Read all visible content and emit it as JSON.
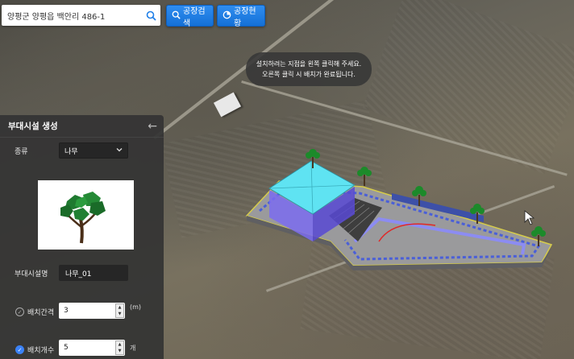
{
  "search": {
    "value": "양평군 양평읍 백안리 486-1",
    "placeholder": ""
  },
  "toolbar": {
    "factory_search_label": "공장검색",
    "factory_status_label": "공장현황"
  },
  "hint": {
    "line1": "설치하려는 지점을 왼쪽 클릭해 주세요.",
    "line2": "오른쪽 클릭 시 배치가 완료됩니다."
  },
  "panel": {
    "title": "부대시설 생성",
    "type_label": "종류",
    "type_value": "나무",
    "name_label": "부대시설명",
    "name_value": "나무_01",
    "interval_label": "배치간격",
    "interval_value": "3",
    "interval_unit": "(m)",
    "count_label": "배치개수",
    "count_value": "5",
    "count_unit": "개"
  },
  "colors": {
    "accent": "#1f7fe8",
    "panel_bg": "#343434",
    "roof": "#5fe3f2",
    "building_wall": "#7b6cf0"
  },
  "icons": {
    "search": "search-icon",
    "status": "chart-icon",
    "back": "back-arrow-icon",
    "select": "chevron-down-icon",
    "check": "check-icon"
  }
}
